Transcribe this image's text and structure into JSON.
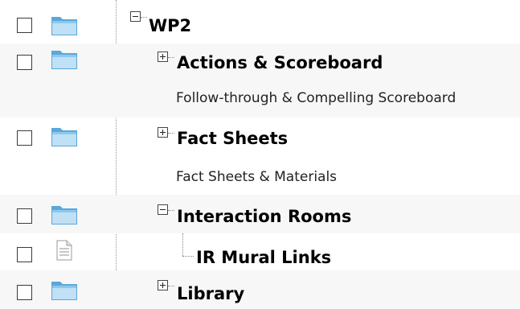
{
  "tree": {
    "nodes": [
      {
        "label": "WP2",
        "expander": "minus",
        "level": 0,
        "icon": "folder-icon",
        "checked": false
      },
      {
        "label": "Actions & Scoreboard",
        "description": "Follow-through & Compelling Scoreboard",
        "expander": "plus",
        "level": 1,
        "icon": "folder-icon",
        "checked": false
      },
      {
        "label": "Fact Sheets",
        "description": "Fact Sheets & Materials",
        "expander": "plus",
        "level": 1,
        "icon": "folder-icon",
        "checked": false
      },
      {
        "label": "Interaction Rooms",
        "expander": "minus",
        "level": 1,
        "icon": "folder-icon",
        "checked": false
      },
      {
        "label": "IR Mural Links",
        "expander": "none",
        "level": 2,
        "icon": "document-icon",
        "checked": false
      },
      {
        "label": "Library",
        "expander": "plus",
        "level": 1,
        "icon": "folder-icon",
        "checked": false
      }
    ]
  },
  "colors": {
    "folder": "#5aa7d9",
    "folder_light": "#bfe0f5",
    "row_alt": "#f7f7f7",
    "tree_line": "#888888"
  }
}
